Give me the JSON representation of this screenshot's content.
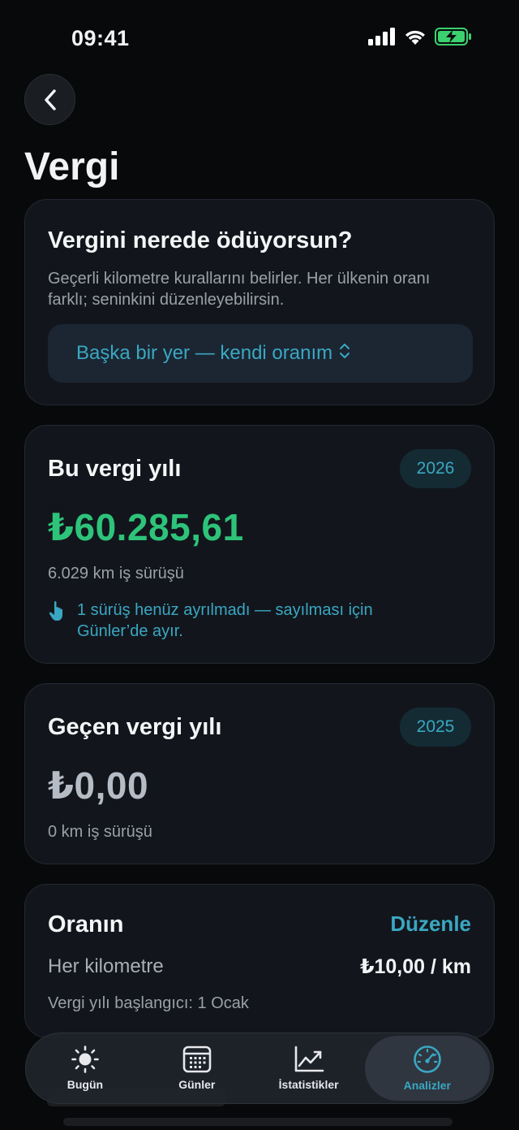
{
  "status": {
    "time": "09:41"
  },
  "page": {
    "title": "Vergi"
  },
  "location": {
    "title": "Vergini nerede ödüyorsun?",
    "description": "Geçerli kilometre kurallarını belirler. Her ülkenin oranı farklı; seninkini düzenleyebilirsin.",
    "selected": "Başka bir yer — kendi oranım"
  },
  "current_year": {
    "title": "Bu vergi yılı",
    "year": "2026",
    "amount": "₺60.285,61",
    "km": "6.029 km iş sürüşü",
    "notice": "1 sürüş henüz ayrılmadı — sayılması için Günler’de ayır."
  },
  "previous_year": {
    "title": "Geçen vergi yılı",
    "year": "2025",
    "amount": "₺0,00",
    "km": "0 km iş sürüşü"
  },
  "rate": {
    "title": "Oranın",
    "edit_label": "Düzenle",
    "label": "Her kilometre",
    "value": "₺10,00 / km",
    "start": "Vergi yılı başlangıcı: 1 Ocak"
  },
  "tabs": [
    {
      "label": "Bugün",
      "icon": "sun-icon"
    },
    {
      "label": "Günler",
      "icon": "calendar-icon"
    },
    {
      "label": "İstatistikler",
      "icon": "chart-icon"
    },
    {
      "label": "Analizler",
      "icon": "gauge-icon"
    }
  ],
  "colors": {
    "accent": "#3aa7c2",
    "positive": "#2ec37a",
    "background": "#08090b",
    "card": "#12161c"
  }
}
